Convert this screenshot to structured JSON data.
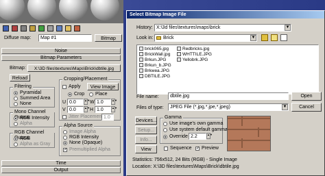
{
  "editor": {
    "toolbar_label": "Diffuse map:",
    "map_name": "Map #1",
    "map_type_button": "Bitmap",
    "rollouts": {
      "noise": "Noise",
      "bitmap_params": "Bitmap Parameters",
      "time": "Time",
      "output": "Output"
    },
    "bitmap_label": "Bitmap:",
    "bitmap_path": "X:\\3D files\\textures\\Maps\\Brick\\dbtile.jpg",
    "reload": "Reload",
    "filtering": {
      "title": "Filtering",
      "options": [
        "Pyramidal",
        "Summed Area",
        "None"
      ],
      "selected": "Pyramidal"
    },
    "mono_output": {
      "title": "Mono Channel Output:",
      "options": [
        "RGB Intensity",
        "Alpha"
      ],
      "selected": "RGB Intensity"
    },
    "rgb_output": {
      "title": "RGB Channel Output:",
      "options": [
        "RGB",
        "Alpha as Gray"
      ],
      "selected": "RGB"
    },
    "cropping": {
      "title": "Cropping/Placement",
      "apply": "Apply",
      "view_image": "View Image",
      "crop": "Crop",
      "place": "Place",
      "u_label": "U",
      "u_val": "0.0",
      "v_label": "V",
      "v_val": "0.0",
      "w_label": "W",
      "w_val": "1.0",
      "h_label": "H",
      "h_val": "1.0",
      "jitter": "Jitter Placement",
      "jitter_val": "1.0"
    },
    "alpha_source": {
      "title": "Alpha Source",
      "options": [
        "Image Alpha",
        "RGB Intensity",
        "None (Opaque)"
      ],
      "selected": "None (Opaque)",
      "premult": "Premultiplied Alpha"
    }
  },
  "dialog": {
    "title": "Select Bitmap Image File",
    "history_label": "History:",
    "history_value": "X:\\3d files\\textures\\maps\\brick",
    "lookin_label": "Look in:",
    "lookin_value": "Brick",
    "files_col1": [
      "brick065.jpg",
      "BrickWall.jpg",
      "Brkun.JPG",
      "Brkun_b.JPG",
      "Brkwea.JPG",
      "DBTILE.JPG"
    ],
    "files_col2": [
      "Redbricks.jpg",
      "WHTTILE.JPG",
      "Yellobrk.JPG"
    ],
    "filename_label": "File name:",
    "filename_value": "dbtile.jpg",
    "open": "Open",
    "filetype_label": "Files of type:",
    "filetype_value": "JPEG File (*.jpg,*.jpe,*.jpeg)",
    "cancel": "Cancel",
    "devices": "Devices...",
    "setup": "Setup...",
    "info": "Info...",
    "view": "View",
    "gamma": {
      "title": "Gamma",
      "options": [
        "Use image's own gamma",
        "Use system default gamma",
        "Override"
      ],
      "selected": "Override",
      "override_val": "2.2"
    },
    "sequence": "Sequence",
    "preview": "Preview",
    "statistics": "Statistics:  756x512, 24 Bits (RGB) - Single Image",
    "location": "Location: X:\\3D files\\textures\\Maps\\Brick\\dbtile.jpg"
  },
  "colors": {
    "titlebar": "#0a246a",
    "brick": "#b4785a",
    "viewport": "#2a3a86"
  }
}
